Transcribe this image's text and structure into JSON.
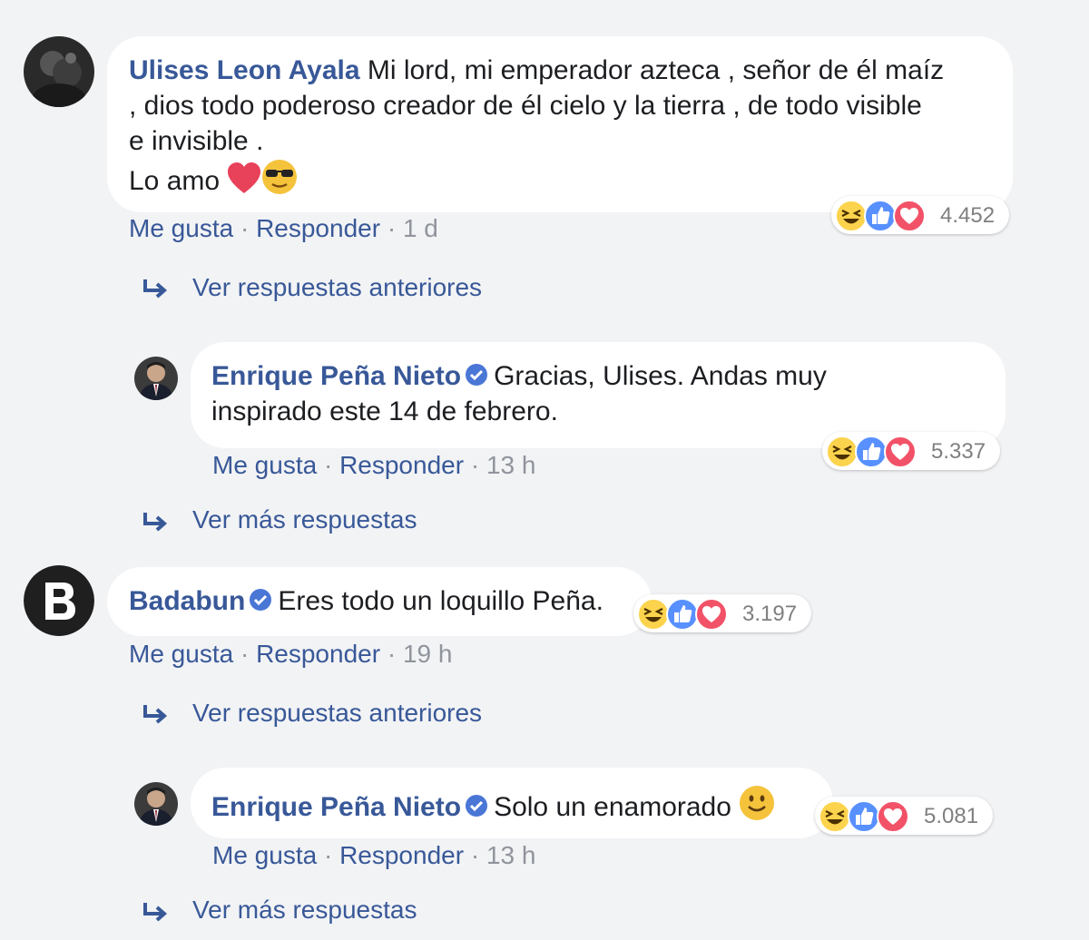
{
  "comments": [
    {
      "author": "Ulises Leon Ayala",
      "text_lines": [
        "Mi lord, mi emperador azteca , señor de él maíz",
        ", dios todo poderoso creador de él cielo y la tierra , de todo visible",
        "e invisible .",
        "Lo amo"
      ],
      "verified": false,
      "reactions_count": "4.452",
      "like_label": "Me gusta",
      "reply_label": "Responder",
      "time": "1 d",
      "replies_link": "Ver respuestas anteriores"
    },
    {
      "author": "Enrique Peña Nieto",
      "text_lines": [
        "Gracias, Ulises. Andas muy",
        "inspirado este 14 de febrero."
      ],
      "verified": true,
      "reactions_count": "5.337",
      "like_label": "Me gusta",
      "reply_label": "Responder",
      "time": "13 h",
      "replies_link": "Ver más respuestas"
    },
    {
      "author": "Badabun",
      "text": "Eres todo un loquillo Peña.",
      "verified": true,
      "reactions_count": "3.197",
      "like_label": "Me gusta",
      "reply_label": "Responder",
      "time": "19 h",
      "replies_link": "Ver respuestas anteriores"
    },
    {
      "author": "Enrique Peña Nieto",
      "text": "Solo un enamorado",
      "verified": true,
      "reactions_count": "5.081",
      "like_label": "Me gusta",
      "reply_label": "Responder",
      "time": "13 h",
      "replies_link": "Ver más respuestas"
    }
  ],
  "separator": "·",
  "icons": {
    "reactions": [
      "haha-icon",
      "like-icon",
      "love-icon"
    ],
    "emojis": [
      "red-heart-emoji",
      "sunglasses-emoji",
      "smiley-emoji"
    ],
    "verified": "verified-badge-icon",
    "reply_arrow": "reply-arrow-icon"
  },
  "colors": {
    "author": "#385898",
    "meta": "#90949c",
    "background": "#f2f3f5",
    "bubble": "#ffffff",
    "like_blue": "#5890ff",
    "love_red": "#f25268",
    "haha_yellow": "#fcd34d"
  }
}
